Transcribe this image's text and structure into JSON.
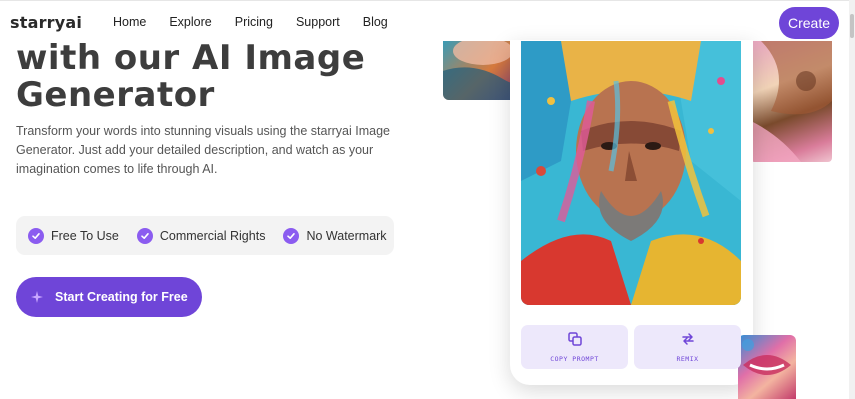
{
  "brand": {
    "logo_text": "starryai"
  },
  "nav": {
    "links": [
      "Home",
      "Explore",
      "Pricing",
      "Support",
      "Blog"
    ],
    "create_label": "Create"
  },
  "hero": {
    "headline_line1": "with our AI Image",
    "headline_line2": "Generator",
    "description": "Transform your words into stunning visuals using the starryai Image Generator. Just add your detailed description, and watch as your imagination comes to life through AI.",
    "features": [
      "Free To Use",
      "Commercial Rights",
      "No Watermark"
    ],
    "cta_label": "Start Creating for Free"
  },
  "preview": {
    "copy_prompt_label": "COPY PROMPT",
    "remix_label": "REMIX"
  },
  "colors": {
    "accent": "#6f45d8",
    "check": "#8b5cf0",
    "feature_bg": "#f3f3f3",
    "action_bg": "#ede8fb"
  }
}
